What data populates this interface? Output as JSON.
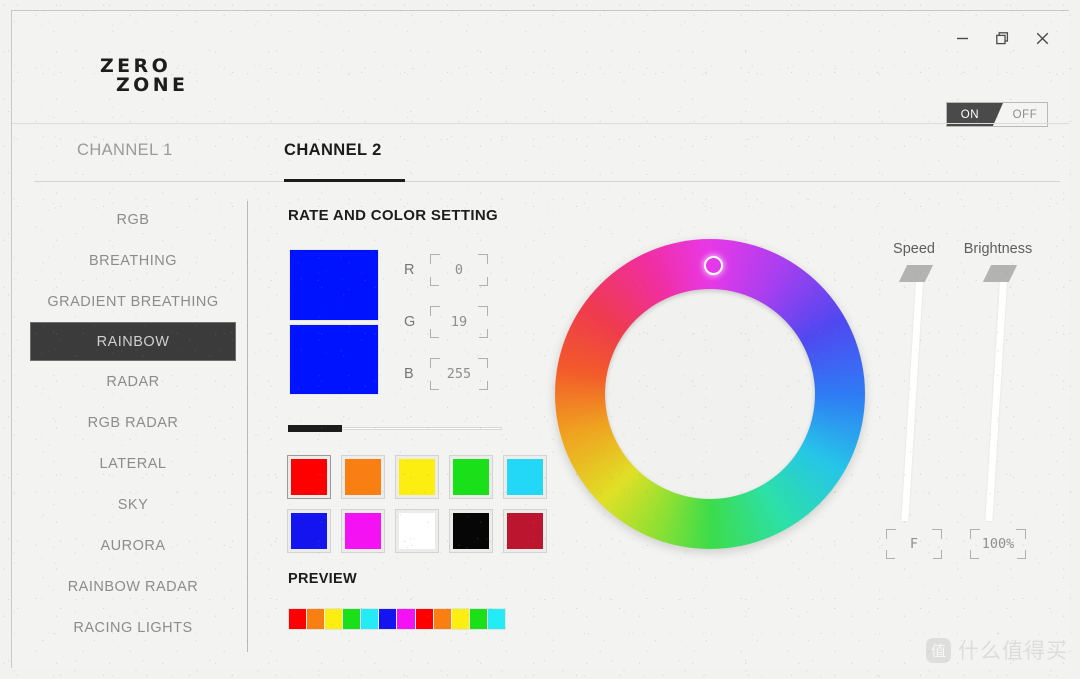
{
  "window": {
    "brand_line1": "ZERO",
    "brand_line2": "ZONE",
    "controls": {
      "minimize": "minimize-icon",
      "restore": "restore-icon",
      "close": "close-icon"
    }
  },
  "power_toggle": {
    "on_label": "ON",
    "off_label": "OFF",
    "state": "ON"
  },
  "tabs": [
    {
      "label": "CHANNEL 1",
      "active": false
    },
    {
      "label": "CHANNEL 2",
      "active": true
    }
  ],
  "sidebar": {
    "items": [
      {
        "label": "RGB",
        "selected": false
      },
      {
        "label": "BREATHING",
        "selected": false
      },
      {
        "label": "GRADIENT BREATHING",
        "selected": false
      },
      {
        "label": "RAINBOW",
        "selected": true
      },
      {
        "label": "RADAR",
        "selected": false
      },
      {
        "label": "RGB RADAR",
        "selected": false
      },
      {
        "label": "LATERAL",
        "selected": false
      },
      {
        "label": "SKY",
        "selected": false
      },
      {
        "label": "AURORA",
        "selected": false
      },
      {
        "label": "RAINBOW RADAR",
        "selected": false
      },
      {
        "label": "RACING LIGHTS",
        "selected": false
      }
    ]
  },
  "main": {
    "section_title": "RATE AND COLOR SETTING",
    "current_color": "#0013ff",
    "rgb": {
      "r_label": "R",
      "r_value": "0",
      "g_label": "G",
      "g_value": "19",
      "b_label": "B",
      "b_value": "255"
    },
    "rate_slider": {
      "percent": 25,
      "fill_color": "#1c1c1c"
    },
    "swatches": [
      {
        "name": "red",
        "color": "#fe0000",
        "selected": true
      },
      {
        "name": "orange",
        "color": "#f97f12",
        "selected": false
      },
      {
        "name": "yellow",
        "color": "#fbee10",
        "selected": false
      },
      {
        "name": "green",
        "color": "#19e019",
        "selected": false
      },
      {
        "name": "cyan",
        "color": "#23d8f7",
        "selected": false
      },
      {
        "name": "blue",
        "color": "#1414f0",
        "selected": false
      },
      {
        "name": "magenta",
        "color": "#f412f4",
        "selected": false
      },
      {
        "name": "white",
        "color": "#ffffff",
        "selected": false
      },
      {
        "name": "black",
        "color": "#060606",
        "selected": false
      },
      {
        "name": "crimson",
        "color": "#bc1530",
        "selected": false
      }
    ],
    "preview": {
      "title": "PREVIEW",
      "segments": [
        "#fe0000",
        "#f97f12",
        "#fbee10",
        "#19e019",
        "#23ecf7",
        "#1414f0",
        "#f412f4",
        "#fe0000",
        "#f97f12",
        "#fbee10",
        "#19e019",
        "#23ecf7"
      ]
    }
  },
  "color_wheel": {
    "marker_hue_label": "magenta",
    "selected_color": "#0013ff"
  },
  "sliders": {
    "speed": {
      "label": "Speed",
      "value": "F"
    },
    "brightness": {
      "label": "Brightness",
      "value": "100%"
    }
  },
  "watermark": {
    "badge": "值",
    "text": "什么值得买"
  }
}
